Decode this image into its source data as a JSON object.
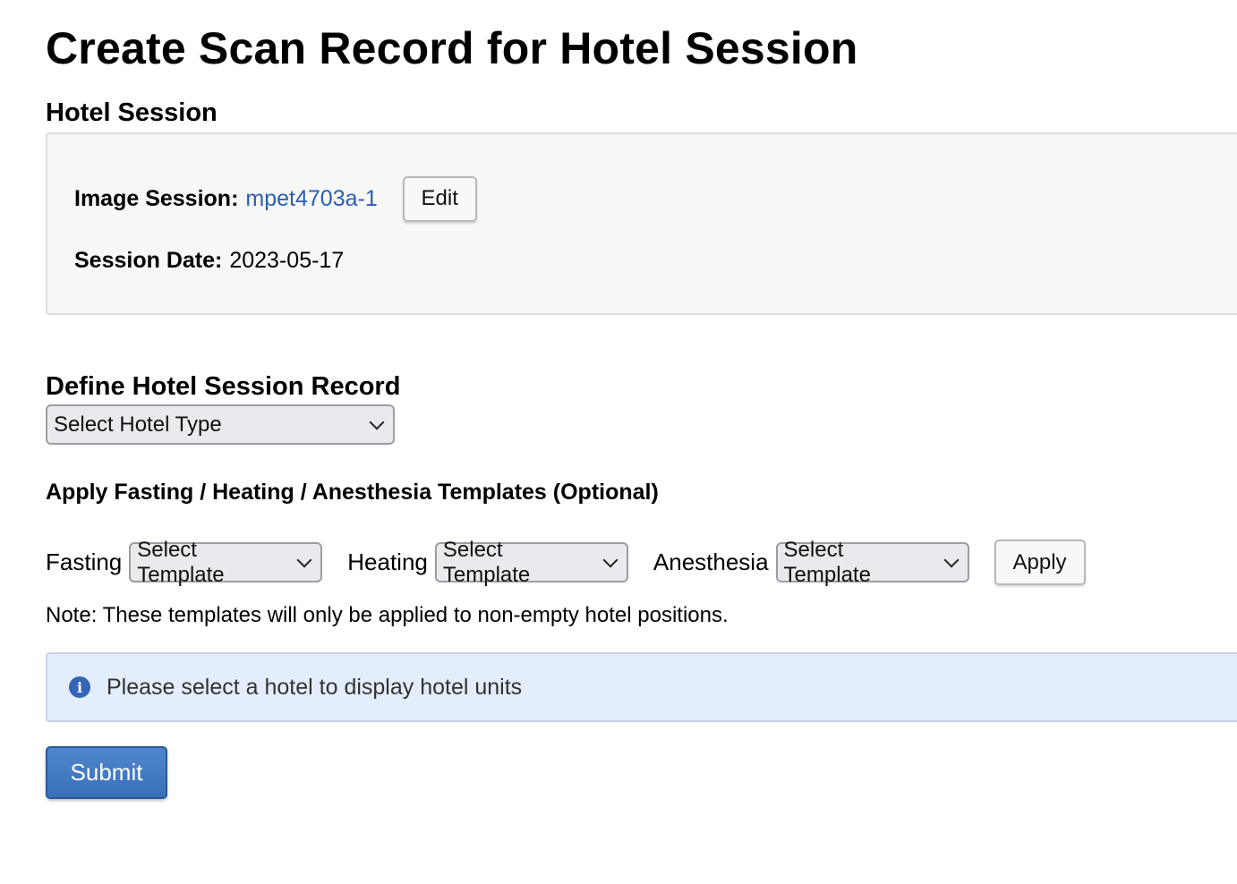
{
  "page": {
    "title": "Create Scan Record for Hotel Session"
  },
  "hotel_session": {
    "heading": "Hotel Session",
    "image_session_label": "Image Session:",
    "image_session_value": "mpet4703a-1",
    "edit_label": "Edit",
    "session_date_label": "Session Date:",
    "session_date_value": "2023-05-17"
  },
  "define_record": {
    "heading": "Define Hotel Session Record",
    "hotel_type_select": "Select Hotel Type"
  },
  "templates": {
    "heading": "Apply Fasting / Heating / Anesthesia Templates (Optional)",
    "fasting_label": "Fasting",
    "fasting_select": "Select Template",
    "heating_label": "Heating",
    "heating_select": "Select Template",
    "anesthesia_label": "Anesthesia",
    "anesthesia_select": "Select Template",
    "apply_label": "Apply",
    "note": "Note: These templates will only be applied to non-empty hotel positions."
  },
  "alert": {
    "icon": "info-icon",
    "icon_glyph": "i",
    "message": "Please select a hotel to display hotel units"
  },
  "actions": {
    "submit_label": "Submit"
  },
  "colors": {
    "link": "#2a5db0",
    "submit_bg": "#3a70b8",
    "alert_bg": "#e3edfb",
    "panel_bg": "#f7f7f7"
  }
}
